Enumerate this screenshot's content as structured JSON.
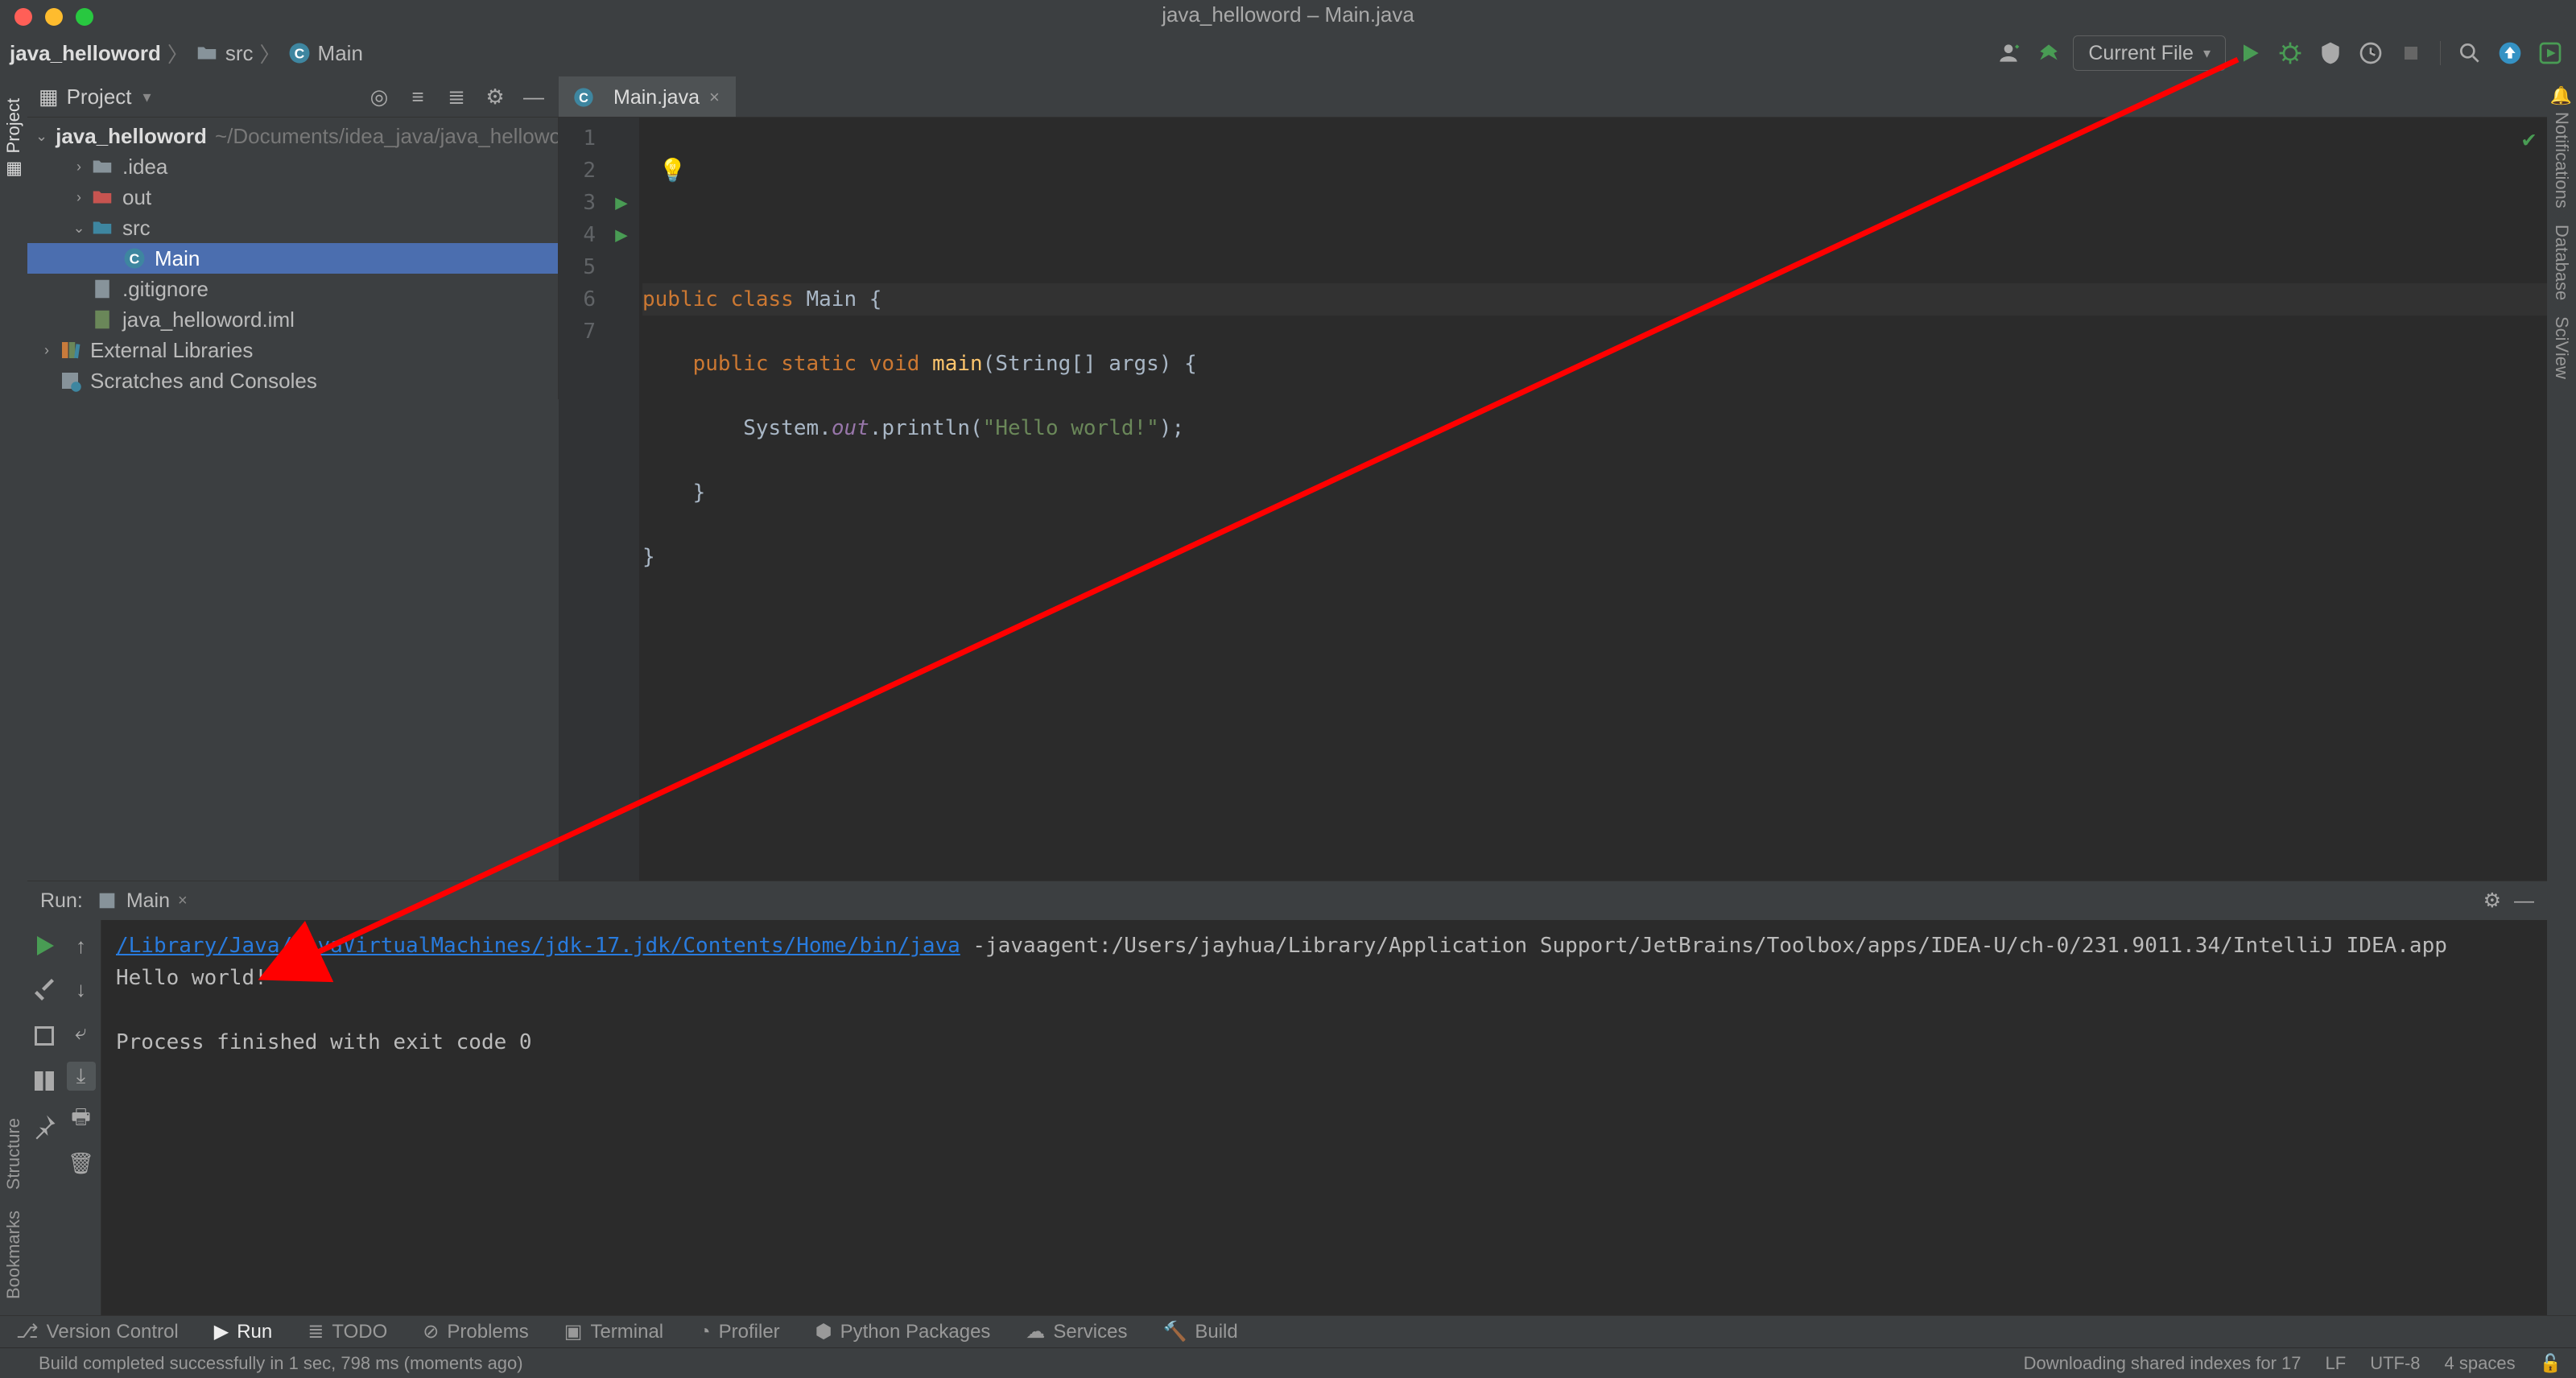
{
  "window": {
    "title": "java_helloword – Main.java"
  },
  "breadcrumbs": {
    "project": "java_helloword",
    "folder": "src",
    "file": "Main"
  },
  "toolbar": {
    "config_label": "Current File"
  },
  "project_tool": {
    "title": "Project"
  },
  "tree": {
    "root_name": "java_helloword",
    "root_path": "~/Documents/idea_java/java_helloword",
    "items": [
      {
        "name": ".idea"
      },
      {
        "name": "out"
      },
      {
        "name": "src"
      },
      {
        "name": "Main"
      },
      {
        "name": ".gitignore"
      },
      {
        "name": "java_helloword.iml"
      }
    ],
    "ext_libs": "External Libraries",
    "scratches": "Scratches and Consoles"
  },
  "tab": {
    "filename": "Main.java"
  },
  "code": {
    "line_nums": [
      "1",
      "2",
      "3",
      "4",
      "5",
      "6",
      "7"
    ],
    "l3_pre": "public class ",
    "l3_cls": "Main",
    "l3_post": " {",
    "l4_k1": "public static void ",
    "l4_m": "main",
    "l4_args": "(String[] args) {",
    "l5_pre": "        System.",
    "l5_field": "out",
    "l5_call": ".println(",
    "l5_str": "\"Hello world!\"",
    "l5_post": ");",
    "l6": "    }",
    "l7": "}"
  },
  "run": {
    "label": "Run:",
    "tab_name": "Main",
    "java_path": "/Library/Java/JavaVirtualMachines/jdk-17.jdk/Contents/Home/bin/java",
    "java_args": " -javaagent:/Users/jayhua/Library/Application Support/JetBrains/Toolbox/apps/IDEA-U/ch-0/231.9011.34/IntelliJ IDEA.app",
    "output": "Hello world!",
    "exit_msg": "Process finished with exit code 0"
  },
  "bottom_tools": {
    "vc": "Version Control",
    "run": "Run",
    "todo": "TODO",
    "problems": "Problems",
    "terminal": "Terminal",
    "profiler": "Profiler",
    "pypkg": "Python Packages",
    "services": "Services",
    "build": "Build"
  },
  "status": {
    "build_msg": "Build completed successfully in 1 sec, 798 ms (moments ago)",
    "dl_msg": "Downloading shared indexes for 17",
    "lf": "LF",
    "enc": "UTF-8",
    "indent": "4 spaces"
  },
  "side_tools": {
    "project": "Project",
    "structure": "Structure",
    "bookmarks": "Bookmarks",
    "notifications": "Notifications",
    "database": "Database",
    "sciview": "SciView"
  }
}
